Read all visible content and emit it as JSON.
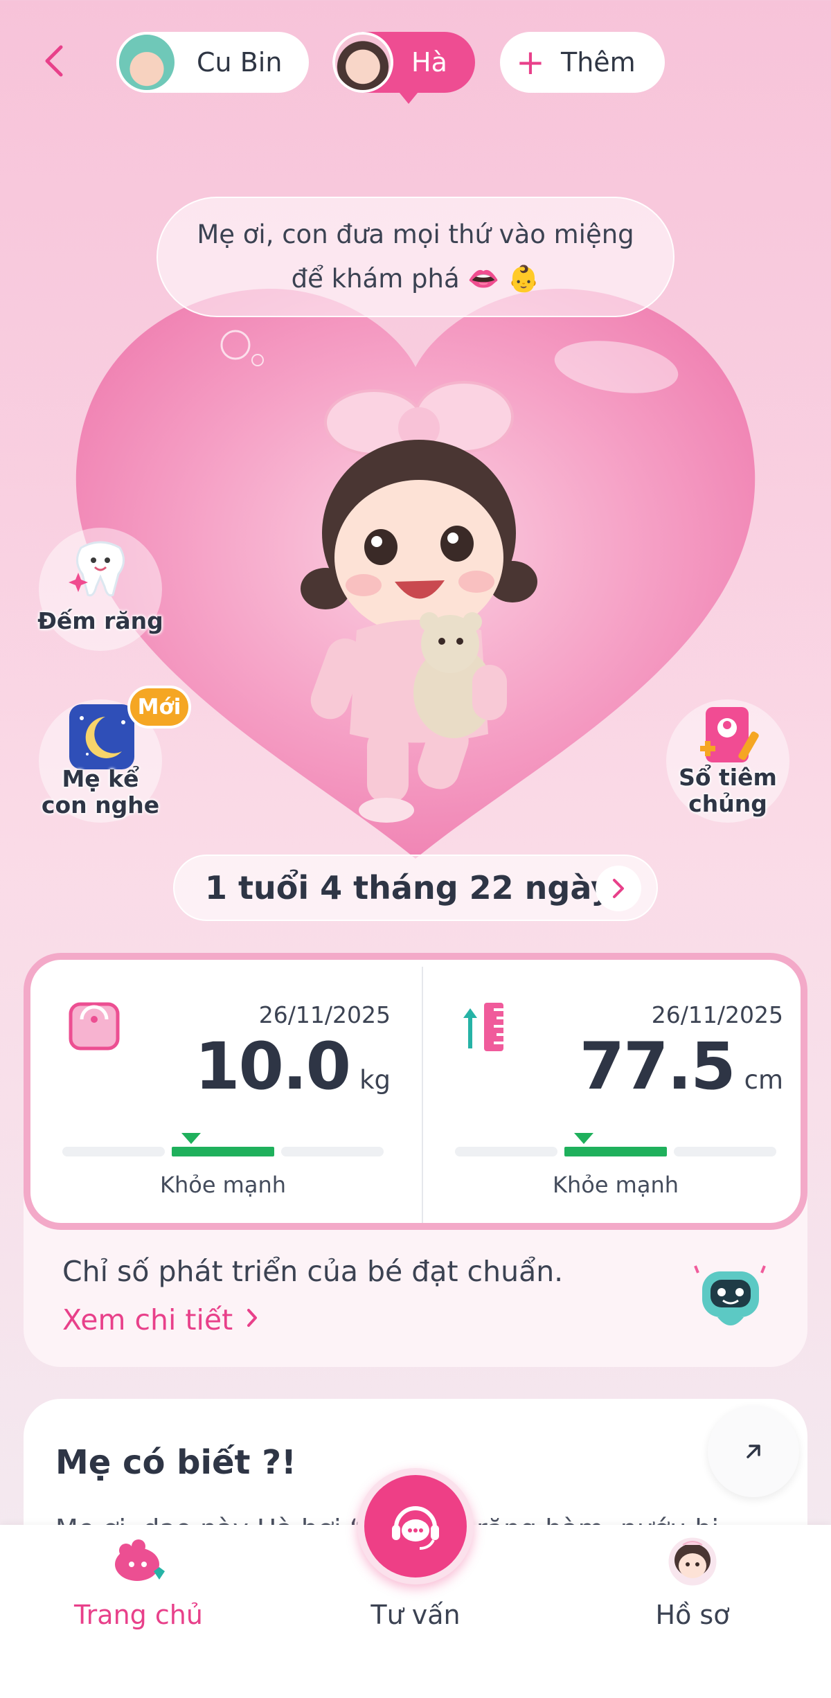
{
  "header": {
    "back_icon": "chevron-left-icon",
    "profiles": [
      {
        "name": "Cu Bin",
        "selected": false
      },
      {
        "name": "Hà",
        "selected": true
      }
    ],
    "add_label": "Thêm"
  },
  "bubble": {
    "line1": "Mẹ ơi, con đưa mọi thứ vào miệng",
    "line2": "để khám phá 👄 👶"
  },
  "side_buttons": {
    "dem_rang": "Đếm răng",
    "me_ke_line1": "Mẹ kể",
    "me_ke_line2": "con nghe",
    "new_badge": "Mới",
    "so_tiem_line1": "Sổ tiêm",
    "so_tiem_line2": "chủng"
  },
  "age": "1 tuổi 4 tháng 22 ngày",
  "metrics": {
    "weight": {
      "date": "26/11/2025",
      "value": "10.0",
      "unit": "kg",
      "status": "Khỏe mạnh",
      "level": "normal"
    },
    "height": {
      "date": "26/11/2025",
      "value": "77.5",
      "unit": "cm",
      "status": "Khỏe mạnh",
      "level": "normal"
    }
  },
  "summary": {
    "text": "Chỉ số phát triển của bé đạt chuẩn.",
    "link": "Xem chi tiết"
  },
  "did_you_know": {
    "title": "Mẹ có biết ?!",
    "text": "Mẹ ơi, dạo này Hà hơi “k... mọc răng hàm, nướu bị"
  },
  "bottom_nav": {
    "home": "Trang chủ",
    "advice": "Tư vấn",
    "profile": "Hồ sơ"
  },
  "colors": {
    "accent": "#ee4d92",
    "healthy": "#1fb05c",
    "text": "#2e3545"
  }
}
